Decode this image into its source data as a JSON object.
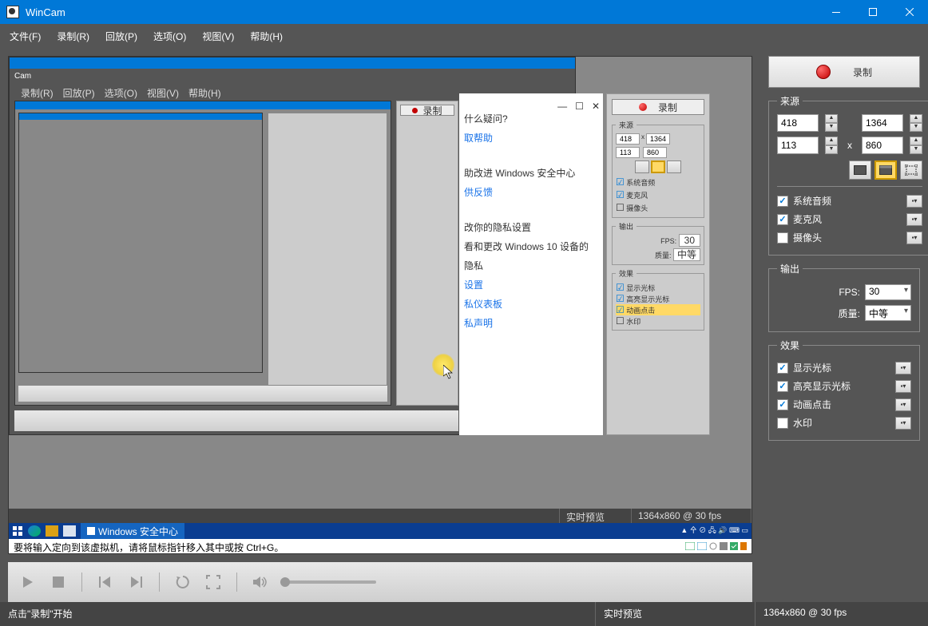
{
  "title": "WinCam",
  "menu": [
    "文件(F)",
    "录制(R)",
    "回放(P)",
    "选项(O)",
    "视图(V)",
    "帮助(H)"
  ],
  "record_label": "录制",
  "source": {
    "legend": "来源",
    "x1": "418",
    "y1": "113",
    "x2": "1364",
    "y2": "860",
    "sep": "x",
    "audio_sys": "系统音频",
    "mic": "麦克风",
    "camera": "摄像头"
  },
  "output": {
    "legend": "输出",
    "fps_label": "FPS:",
    "fps_value": "30",
    "quality_label": "质量:",
    "quality_value": "中等"
  },
  "effects": {
    "legend": "效果",
    "cursor": "显示光标",
    "highlight": "高亮显示光标",
    "click": "动画点击",
    "watermark": "水印"
  },
  "status": {
    "left": "点击\"录制\"开始",
    "mid": "实时预览",
    "right": "1364x860 @ 30 fps"
  },
  "preview": {
    "status_mid": "实时预览",
    "status_right": "1364x860 @ 30 fps",
    "hint": "要将输入定向到该虚拟机，请将鼠标指针移入其中或按 Ctrl+G。",
    "taskbar_app": "Windows 安全中心"
  }
}
